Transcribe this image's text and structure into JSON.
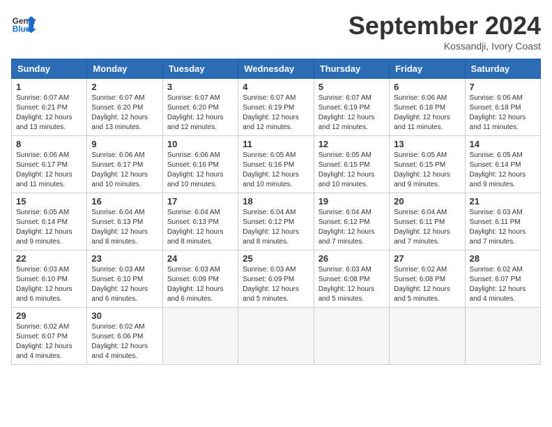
{
  "header": {
    "logo_general": "General",
    "logo_blue": "Blue",
    "month_title": "September 2024",
    "location": "Kossandji, Ivory Coast"
  },
  "weekdays": [
    "Sunday",
    "Monday",
    "Tuesday",
    "Wednesday",
    "Thursday",
    "Friday",
    "Saturday"
  ],
  "weeks": [
    [
      {
        "day": "1",
        "sunrise": "6:07 AM",
        "sunset": "6:21 PM",
        "daylight": "12 hours and 13 minutes."
      },
      {
        "day": "2",
        "sunrise": "6:07 AM",
        "sunset": "6:20 PM",
        "daylight": "12 hours and 13 minutes."
      },
      {
        "day": "3",
        "sunrise": "6:07 AM",
        "sunset": "6:20 PM",
        "daylight": "12 hours and 12 minutes."
      },
      {
        "day": "4",
        "sunrise": "6:07 AM",
        "sunset": "6:19 PM",
        "daylight": "12 hours and 12 minutes."
      },
      {
        "day": "5",
        "sunrise": "6:07 AM",
        "sunset": "6:19 PM",
        "daylight": "12 hours and 12 minutes."
      },
      {
        "day": "6",
        "sunrise": "6:06 AM",
        "sunset": "6:18 PM",
        "daylight": "12 hours and 11 minutes."
      },
      {
        "day": "7",
        "sunrise": "6:06 AM",
        "sunset": "6:18 PM",
        "daylight": "12 hours and 11 minutes."
      }
    ],
    [
      {
        "day": "8",
        "sunrise": "6:06 AM",
        "sunset": "6:17 PM",
        "daylight": "12 hours and 11 minutes."
      },
      {
        "day": "9",
        "sunrise": "6:06 AM",
        "sunset": "6:17 PM",
        "daylight": "12 hours and 10 minutes."
      },
      {
        "day": "10",
        "sunrise": "6:06 AM",
        "sunset": "6:16 PM",
        "daylight": "12 hours and 10 minutes."
      },
      {
        "day": "11",
        "sunrise": "6:05 AM",
        "sunset": "6:16 PM",
        "daylight": "12 hours and 10 minutes."
      },
      {
        "day": "12",
        "sunrise": "6:05 AM",
        "sunset": "6:15 PM",
        "daylight": "12 hours and 10 minutes."
      },
      {
        "day": "13",
        "sunrise": "6:05 AM",
        "sunset": "6:15 PM",
        "daylight": "12 hours and 9 minutes."
      },
      {
        "day": "14",
        "sunrise": "6:05 AM",
        "sunset": "6:14 PM",
        "daylight": "12 hours and 9 minutes."
      }
    ],
    [
      {
        "day": "15",
        "sunrise": "6:05 AM",
        "sunset": "6:14 PM",
        "daylight": "12 hours and 9 minutes."
      },
      {
        "day": "16",
        "sunrise": "6:04 AM",
        "sunset": "6:13 PM",
        "daylight": "12 hours and 8 minutes."
      },
      {
        "day": "17",
        "sunrise": "6:04 AM",
        "sunset": "6:13 PM",
        "daylight": "12 hours and 8 minutes."
      },
      {
        "day": "18",
        "sunrise": "6:04 AM",
        "sunset": "6:12 PM",
        "daylight": "12 hours and 8 minutes."
      },
      {
        "day": "19",
        "sunrise": "6:04 AM",
        "sunset": "6:12 PM",
        "daylight": "12 hours and 7 minutes."
      },
      {
        "day": "20",
        "sunrise": "6:04 AM",
        "sunset": "6:11 PM",
        "daylight": "12 hours and 7 minutes."
      },
      {
        "day": "21",
        "sunrise": "6:03 AM",
        "sunset": "6:11 PM",
        "daylight": "12 hours and 7 minutes."
      }
    ],
    [
      {
        "day": "22",
        "sunrise": "6:03 AM",
        "sunset": "6:10 PM",
        "daylight": "12 hours and 6 minutes."
      },
      {
        "day": "23",
        "sunrise": "6:03 AM",
        "sunset": "6:10 PM",
        "daylight": "12 hours and 6 minutes."
      },
      {
        "day": "24",
        "sunrise": "6:03 AM",
        "sunset": "6:09 PM",
        "daylight": "12 hours and 6 minutes."
      },
      {
        "day": "25",
        "sunrise": "6:03 AM",
        "sunset": "6:09 PM",
        "daylight": "12 hours and 5 minutes."
      },
      {
        "day": "26",
        "sunrise": "6:03 AM",
        "sunset": "6:08 PM",
        "daylight": "12 hours and 5 minutes."
      },
      {
        "day": "27",
        "sunrise": "6:02 AM",
        "sunset": "6:08 PM",
        "daylight": "12 hours and 5 minutes."
      },
      {
        "day": "28",
        "sunrise": "6:02 AM",
        "sunset": "6:07 PM",
        "daylight": "12 hours and 4 minutes."
      }
    ],
    [
      {
        "day": "29",
        "sunrise": "6:02 AM",
        "sunset": "6:07 PM",
        "daylight": "12 hours and 4 minutes."
      },
      {
        "day": "30",
        "sunrise": "6:02 AM",
        "sunset": "6:06 PM",
        "daylight": "12 hours and 4 minutes."
      },
      null,
      null,
      null,
      null,
      null
    ]
  ]
}
